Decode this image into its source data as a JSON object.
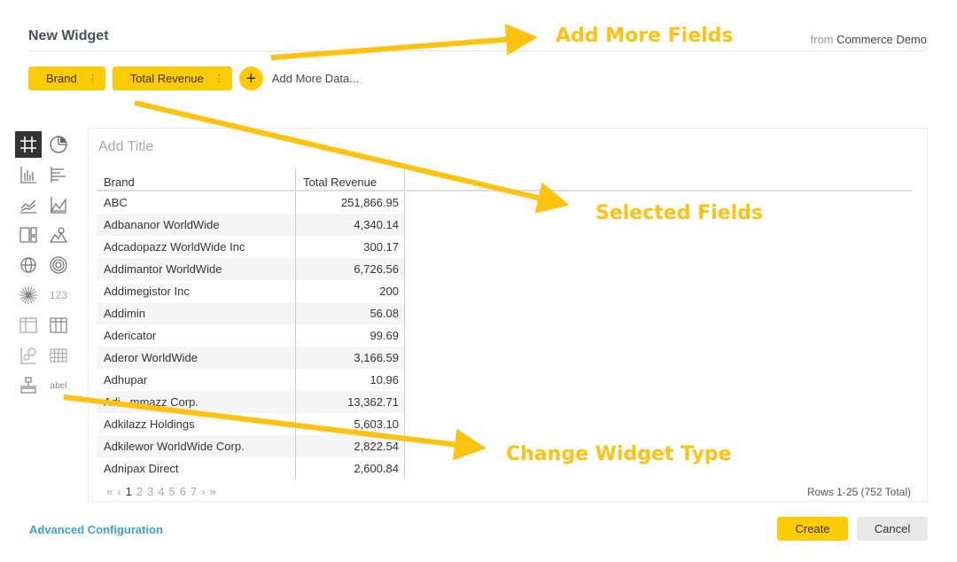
{
  "header": {
    "title": "New Widget",
    "from_label": "from",
    "source_name": "Commerce Demo"
  },
  "fields": {
    "chips": [
      "Brand",
      "Total Revenue"
    ],
    "add_label": "Add More Data..."
  },
  "palette": {
    "text_icons": [
      "123",
      "abel"
    ]
  },
  "widget": {
    "title_placeholder": "Add Title",
    "columns": [
      "Brand",
      "Total Revenue"
    ],
    "rows": [
      [
        "ABC",
        "251,866.95"
      ],
      [
        "Adbananor WorldWide",
        "4,340.14"
      ],
      [
        "Adcadopazz WorldWide Inc",
        "300.17"
      ],
      [
        "Addimantor WorldWide",
        "6,726.56"
      ],
      [
        "Addimegistor Inc",
        "200"
      ],
      [
        "Addimin",
        "56.08"
      ],
      [
        "Adericator",
        "99.69"
      ],
      [
        "Aderor WorldWide",
        "3,166.59"
      ],
      [
        "Adhupar",
        "10.96"
      ],
      [
        "Adi...mmazz Corp.",
        "13,362.71"
      ],
      [
        "Adkilazz Holdings",
        "5,603.10"
      ],
      [
        "Adkilewor WorldWide Corp.",
        "2,822.54"
      ],
      [
        "Adnipax Direct",
        "2,600.84"
      ]
    ],
    "pager": {
      "first": "«",
      "prev": "‹",
      "pages": [
        "1",
        "2",
        "3",
        "4",
        "5",
        "6",
        "7"
      ],
      "next": "›",
      "last": "»"
    },
    "rows_info": "Rows 1-25 (752 Total)"
  },
  "footer": {
    "advanced": "Advanced Configuration",
    "create": "Create",
    "cancel": "Cancel"
  },
  "annotations": {
    "add_more_fields": "Add More Fields",
    "selected_fields": "Selected Fields",
    "change_widget_type": "Change Widget Type"
  },
  "colors": {
    "accent": "#ffcb05",
    "annotation": "#ffc20e",
    "link": "#3aa0d8"
  }
}
